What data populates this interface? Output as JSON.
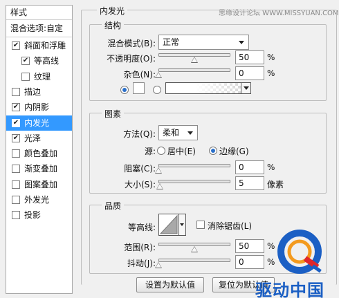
{
  "watermark": "思缘设计论坛 WWW.MISSYUAN.COM",
  "style_list": {
    "header": "样式",
    "blend_options": "混合选项:自定",
    "items": [
      {
        "label": "斜面和浮雕",
        "checked": true,
        "indent": false,
        "selected": false
      },
      {
        "label": "等高线",
        "checked": true,
        "indent": true,
        "selected": false
      },
      {
        "label": "纹理",
        "checked": false,
        "indent": true,
        "selected": false
      },
      {
        "label": "描边",
        "checked": false,
        "indent": false,
        "selected": false
      },
      {
        "label": "内阴影",
        "checked": true,
        "indent": false,
        "selected": false
      },
      {
        "label": "内发光",
        "checked": true,
        "indent": false,
        "selected": true
      },
      {
        "label": "光泽",
        "checked": true,
        "indent": false,
        "selected": false
      },
      {
        "label": "颜色叠加",
        "checked": false,
        "indent": false,
        "selected": false
      },
      {
        "label": "渐变叠加",
        "checked": false,
        "indent": false,
        "selected": false
      },
      {
        "label": "图案叠加",
        "checked": false,
        "indent": false,
        "selected": false
      },
      {
        "label": "外发光",
        "checked": false,
        "indent": false,
        "selected": false
      },
      {
        "label": "投影",
        "checked": false,
        "indent": false,
        "selected": false
      }
    ]
  },
  "panel_title": "内发光",
  "structure": {
    "title": "结构",
    "blend_mode_label": "混合模式(B):",
    "blend_mode_value": "正常",
    "opacity_label": "不透明度(O):",
    "opacity_value": "50",
    "opacity_level": 0.5,
    "noise_label": "杂色(N):",
    "noise_value": "0",
    "noise_level": 0.0,
    "percent": "%"
  },
  "elements": {
    "title": "图素",
    "method_label": "方法(Q):",
    "method_value": "柔和",
    "source_label": "源:",
    "source_center": "居中(E)",
    "source_edge": "边缘(G)",
    "choke_label": "阻塞(C):",
    "choke_value": "0",
    "choke_level": 0.0,
    "size_label": "大小(S):",
    "size_value": "5",
    "size_level": 0.02,
    "percent": "%",
    "pixels": "像素"
  },
  "quality": {
    "title": "品质",
    "contour_label": "等高线:",
    "antialias_label": "消除锯齿(L)",
    "range_label": "范围(R):",
    "range_value": "50",
    "range_level": 0.5,
    "jitter_label": "抖动(J):",
    "jitter_value": "0",
    "jitter_level": 0.0,
    "percent": "%"
  },
  "buttons": {
    "make_default": "设置为默认值",
    "reset_default": "复位为默认值"
  },
  "logo": {
    "text": "驱动中国",
    "colors": {
      "blue": "#1b5fc4",
      "red": "#e0262b",
      "orange": "#f39a1e"
    }
  }
}
